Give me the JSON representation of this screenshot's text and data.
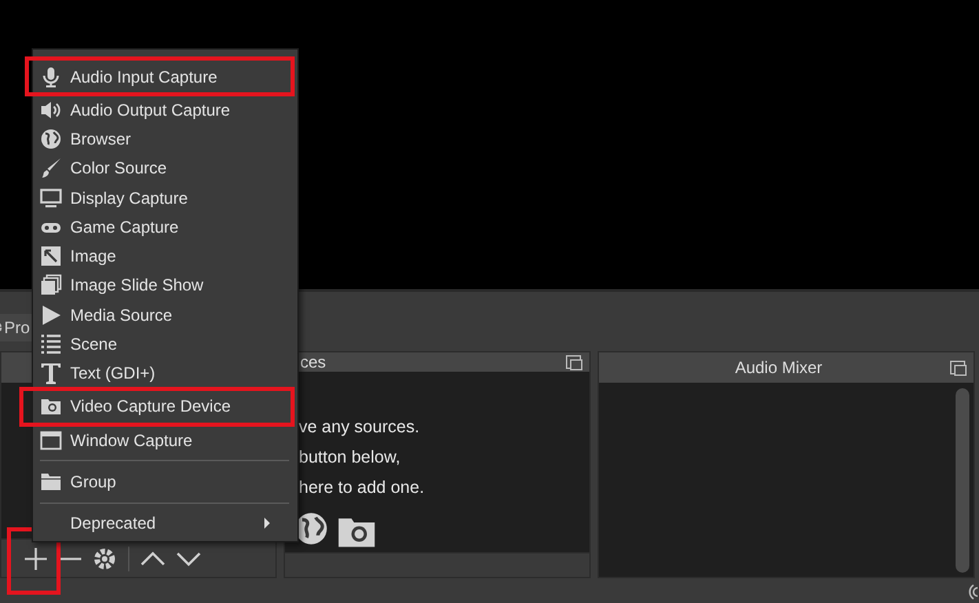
{
  "dock_tabs": [
    {
      "label": "Pro"
    }
  ],
  "sources_panel": {
    "title": "ces",
    "empty_message": [
      "ve any sources.",
      "button below,",
      "here to add one."
    ]
  },
  "audio_mixer": {
    "title": "Audio Mixer"
  },
  "add_menu": {
    "items": [
      {
        "kind": "item",
        "label": "Audio Input Capture",
        "highlighted": true
      },
      {
        "kind": "item",
        "label": "Audio Output Capture",
        "highlighted": false
      },
      {
        "kind": "item",
        "label": "Browser",
        "highlighted": false
      },
      {
        "kind": "item",
        "label": "Color Source",
        "highlighted": false
      },
      {
        "kind": "item",
        "label": "Display Capture",
        "highlighted": false
      },
      {
        "kind": "item",
        "label": "Game Capture",
        "highlighted": false
      },
      {
        "kind": "item",
        "label": "Image",
        "highlighted": false
      },
      {
        "kind": "item",
        "label": "Image Slide Show",
        "highlighted": false
      },
      {
        "kind": "item",
        "label": "Media Source",
        "highlighted": false
      },
      {
        "kind": "item",
        "label": "Scene",
        "highlighted": false
      },
      {
        "kind": "item",
        "label": "Text (GDI+)",
        "highlighted": false
      },
      {
        "kind": "item",
        "label": "Video Capture Device",
        "highlighted": true
      },
      {
        "kind": "item",
        "label": "Window Capture",
        "highlighted": false
      },
      {
        "kind": "separator"
      },
      {
        "kind": "item",
        "label": "Group",
        "highlighted": false
      },
      {
        "kind": "separator"
      },
      {
        "kind": "submenu",
        "label": "Deprecated",
        "highlighted": false
      }
    ]
  },
  "toolbar": {
    "add_highlighted": true
  }
}
